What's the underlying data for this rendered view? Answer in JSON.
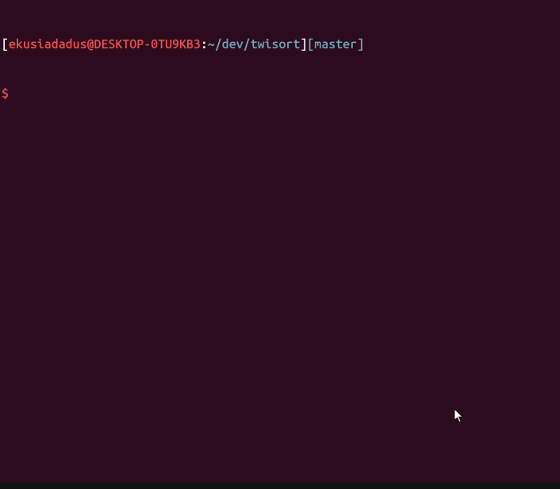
{
  "prompt": {
    "open_bracket_1": "[",
    "user_host": "ekusiadadus@DESKTOP-0TU9KB3",
    "colon": ":",
    "path": "~/dev/twisort",
    "close_bracket_1": "]",
    "open_bracket_2": "[",
    "branch": "master",
    "close_bracket_2": "]",
    "symbol": "$"
  },
  "command_input": ""
}
